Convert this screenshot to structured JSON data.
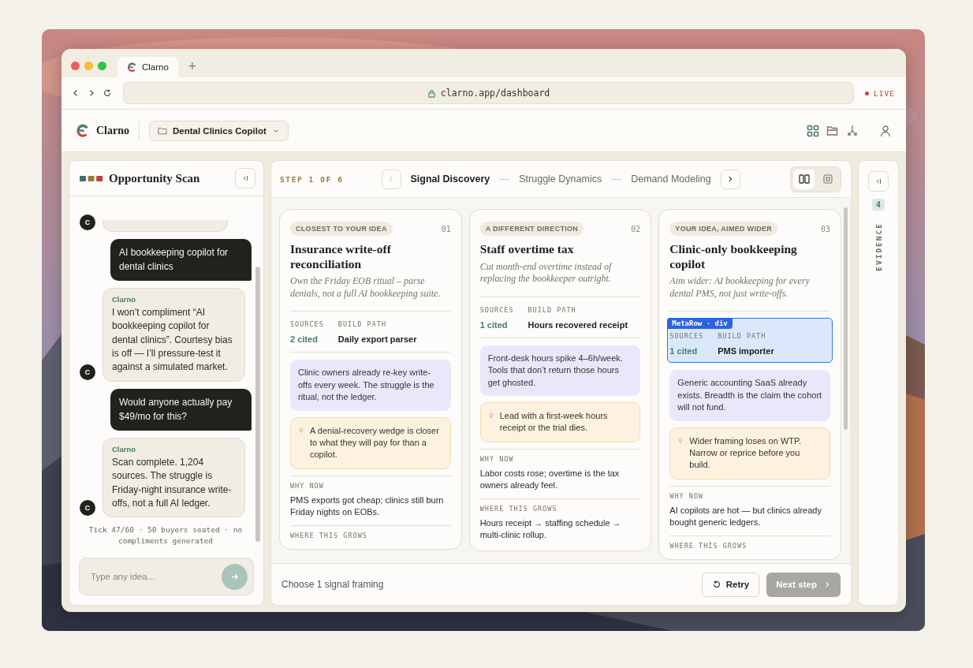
{
  "browser": {
    "tab_title": "Clarno",
    "new_tab": "+",
    "url": "clarno.app/dashboard",
    "live": "LIVE"
  },
  "app": {
    "brand": "Clarno",
    "project": "Dental Clinics Copilot",
    "tools": [
      {
        "kind": "grid",
        "selected": true
      },
      {
        "kind": "folder",
        "selected": false
      },
      {
        "kind": "merge",
        "selected": false
      },
      {
        "kind": "user",
        "selected": false
      }
    ]
  },
  "chat": {
    "title": "Opportunity Scan",
    "messages": [
      {
        "kind": "fragment",
        "avatar": "C"
      },
      {
        "kind": "user",
        "text": "AI bookkeeping copilot for dental clinics"
      },
      {
        "kind": "assistant",
        "author": "Clarno",
        "avatar": "C",
        "text": "I won’t compliment “AI bookkeeping copilot for dental clinics”. Courtesy bias is off — I’ll pressure-test it against a simulated market."
      },
      {
        "kind": "user",
        "text": "Would anyone actually pay $49/mo for this?"
      },
      {
        "kind": "assistant",
        "author": "Clarno",
        "avatar": "C",
        "text": "Scan complete. 1,204 sources. The struggle is Friday-night insurance write-offs, not a full AI ledger."
      }
    ],
    "status": "Tick 47/60 · 50 buyers seated · no compliments generated",
    "placeholder": "Type any idea..."
  },
  "scan": {
    "step": "STEP 1 OF 6",
    "steps": [
      {
        "label": "Signal Discovery",
        "selected": true
      },
      {
        "label": "Struggle Dynamics",
        "selected": false
      },
      {
        "label": "Demand Modeling",
        "selected": false
      }
    ],
    "views": [
      {
        "kind": "columns",
        "selected": true
      },
      {
        "kind": "focus",
        "selected": false
      }
    ],
    "cards": [
      {
        "tag": "CLOSEST TO YOUR IDEA",
        "number": "01",
        "title": "Insurance write-off reconciliation",
        "subtitle": "Own the Friday EOB ritual – parse denials, not a full AI bookkeeping suite.",
        "sources_label": "SOURCES",
        "sources": "2 cited",
        "build_label": "BUILD PATH",
        "build": "Daily export parser",
        "insight": "Clinic owners already re-key write-offs every week. The struggle is the ritual, not the ledger.",
        "tip": "A denial-recovery wedge is closer to what they will pay for than a copilot.",
        "why_label": "WHY NOW",
        "why": "PMS exports got cheap; clinics still burn Friday nights on EOBs.",
        "grows_label": "WHERE THIS GROWS",
        "inspected": false
      },
      {
        "tag": "A DIFFERENT DIRECTION",
        "number": "02",
        "title": "Staff overtime tax",
        "subtitle": "Cut month-end overtime instead of replacing the bookkeeper outright.",
        "sources_label": "SOURCES",
        "sources": "1 cited",
        "build_label": "BUILD PATH",
        "build": "Hours recovered receipt",
        "insight": "Front-desk hours spike 4–6h/week. Tools that don’t return those hours get ghosted.",
        "tip": "Lead with a first-week hours receipt or the trial dies.",
        "why_label": "WHY NOW",
        "why": "Labor costs rose; overtime is the tax owners already feel.",
        "grows_label": "WHERE THIS GROWS",
        "grows": "Hours receipt → staffing schedule → multi-clinic rollup.",
        "inspected": false
      },
      {
        "tag": "YOUR IDEA, AIMED WIDER",
        "number": "03",
        "title": "Clinic-only bookkeeping copilot",
        "subtitle": "Aim wider: AI bookkeeping for every dental PMS, not just write-offs.",
        "sources_label": "SOURCES",
        "sources": "1 cited",
        "build_label": "BUILD PATH",
        "build": "PMS importer",
        "insight": "Generic accounting SaaS already exists. Breadth is the claim the cohort will not fund.",
        "tip": "Wider framing loses on WTP. Narrow or reprice before you build.",
        "why_label": "WHY NOW",
        "why": "AI copilots are hot — but clinics already bought generic ledgers.",
        "grows_label": "WHERE THIS GROWS",
        "inspected": true
      }
    ],
    "inspector_label": "MetaRow · div",
    "footer": {
      "hint": "Choose 1 signal framing",
      "retry": "Retry",
      "next": "Next step",
      "next_disabled": true
    }
  },
  "evidence": {
    "count": "4",
    "label": "EVIDENCE"
  }
}
